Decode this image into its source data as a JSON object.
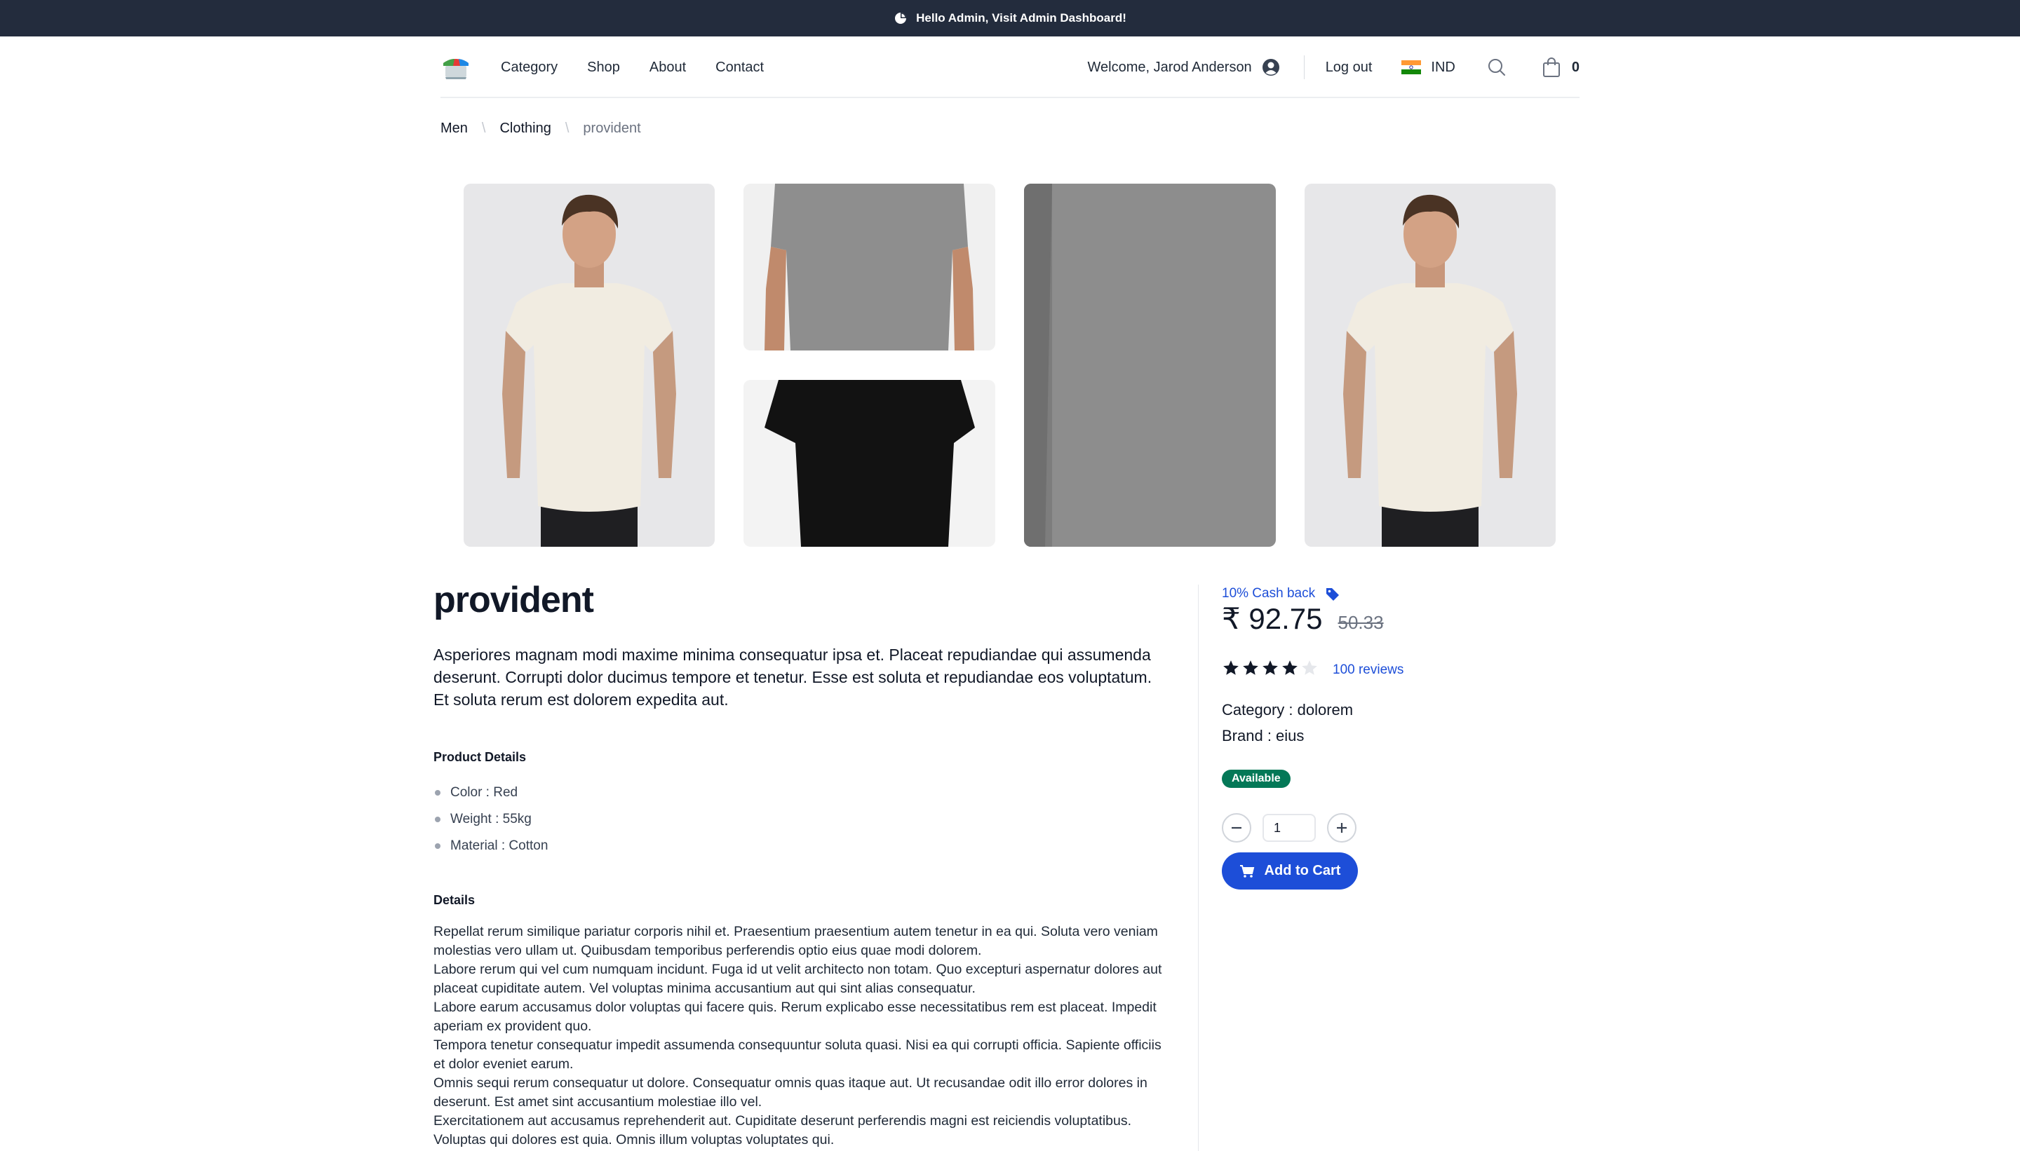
{
  "banner": {
    "text": "Hello Admin, Visit Admin Dashboard!",
    "icon": "pie-chart-icon"
  },
  "nav": {
    "links": [
      "Category",
      "Shop",
      "About",
      "Contact"
    ],
    "welcome": "Welcome, Jarod Anderson",
    "logout": "Log out",
    "country": "IND",
    "cart_count": "0"
  },
  "breadcrumb": {
    "items": [
      "Men",
      "Clothing"
    ],
    "current": "provident"
  },
  "product": {
    "title": "provident",
    "description": "Asperiores magnam modi maxime minima consequatur ipsa et. Placeat repudiandae qui assumenda deserunt. Corrupti dolor ducimus tempore et tenetur. Esse est soluta et repudiandae eos voluptatum. Et soluta rerum est dolorem expedita aut.",
    "details_heading": "Product Details",
    "specs": [
      "Color : Red",
      "Weight : 55kg",
      "Material : Cotton"
    ],
    "long_heading": "Details",
    "long_text": [
      "Repellat rerum similique pariatur corporis nihil et. Praesentium praesentium autem tenetur in ea qui. Soluta vero veniam molestias vero ullam ut. Quibusdam temporibus perferendis optio eius quae modi dolorem.",
      "Labore rerum qui vel cum numquam incidunt. Fuga id ut velit architecto non totam. Quo excepturi aspernatur dolores aut placeat cupiditate autem. Vel voluptas minima accusantium aut qui sint alias consequatur.",
      "Labore earum accusamus dolor voluptas qui facere quis. Rerum explicabo esse necessitatibus rem est placeat. Impedit aperiam ex provident quo.",
      "Tempora tenetur consequatur impedit assumenda consequuntur soluta quasi. Nisi ea qui corrupti officia. Sapiente officiis et dolor eveniet earum.",
      "Omnis sequi rerum consequatur ut dolore. Consequatur omnis quas itaque aut. Ut recusandae odit illo error dolores in deserunt. Est amet sint accusantium molestiae illo vel.",
      "Exercitationem aut accusamus reprehenderit aut. Cupiditate deserunt perferendis magni est reiciendis voluptatibus. Voluptas qui dolores est quia. Omnis illum voluptas voluptates qui."
    ]
  },
  "purchase": {
    "cashback": "10% Cash back",
    "price": "₹ 92.75",
    "old_price": "50.33",
    "rating": 4,
    "rating_max": 5,
    "reviews": "100 reviews",
    "category": "Category : dolorem",
    "brand": "Brand : eius",
    "availability": "Available",
    "quantity": "1",
    "add_to_cart": "Add to Cart"
  },
  "colors": {
    "banner": "#232c3d",
    "accent": "#1d4ed8",
    "available": "#047857"
  }
}
